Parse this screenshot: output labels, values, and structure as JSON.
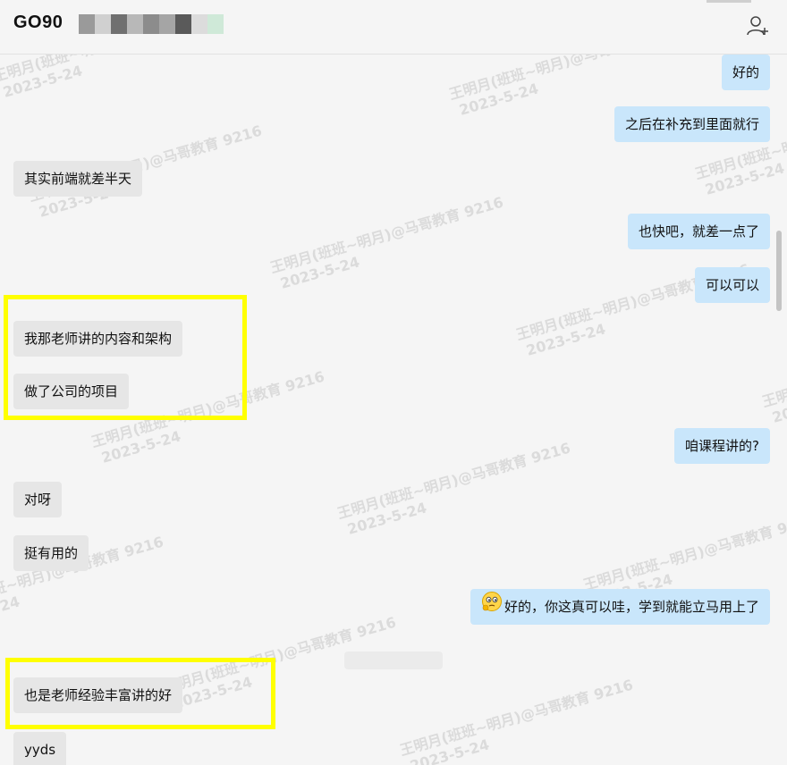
{
  "header": {
    "title": "GO90",
    "mosaic_colors": [
      "#9a9a9a",
      "#d0d0d0",
      "#707070",
      "#b8b8b8",
      "#8c8c8c",
      "#a5a5a5",
      "#5a5a5a",
      "#dcdcdc",
      "#cfe9d8"
    ]
  },
  "watermark": {
    "line1": "王明月(班班~明月)@马哥教育 9216",
    "line2": "2023-5-24"
  },
  "messages": [
    {
      "side": "right",
      "text": "好的"
    },
    {
      "side": "right",
      "text": "之后在补充到里面就行"
    },
    {
      "side": "left",
      "text": "其实前端就差半天"
    },
    {
      "side": "right",
      "text": "也快吧，就差一点了"
    },
    {
      "side": "right",
      "text": "可以可以"
    },
    {
      "side": "left",
      "text": "我那老师讲的内容和架构"
    },
    {
      "side": "left",
      "text": "做了公司的项目"
    },
    {
      "side": "right",
      "text": "咱课程讲的?"
    },
    {
      "side": "left",
      "text": "对呀"
    },
    {
      "side": "left",
      "text": "挺有用的"
    },
    {
      "side": "right",
      "text": "好的，你这真可以哇，学到就能立马用上了",
      "emoji": "thinking-face-icon"
    },
    {
      "side": "left",
      "text": "也是老师经验丰富讲的好"
    },
    {
      "side": "left",
      "text": "yyds"
    }
  ],
  "colors": {
    "highlight": "#ffff00",
    "bubble_left": "#e6e6e6",
    "bubble_right": "#c9e6fb"
  }
}
